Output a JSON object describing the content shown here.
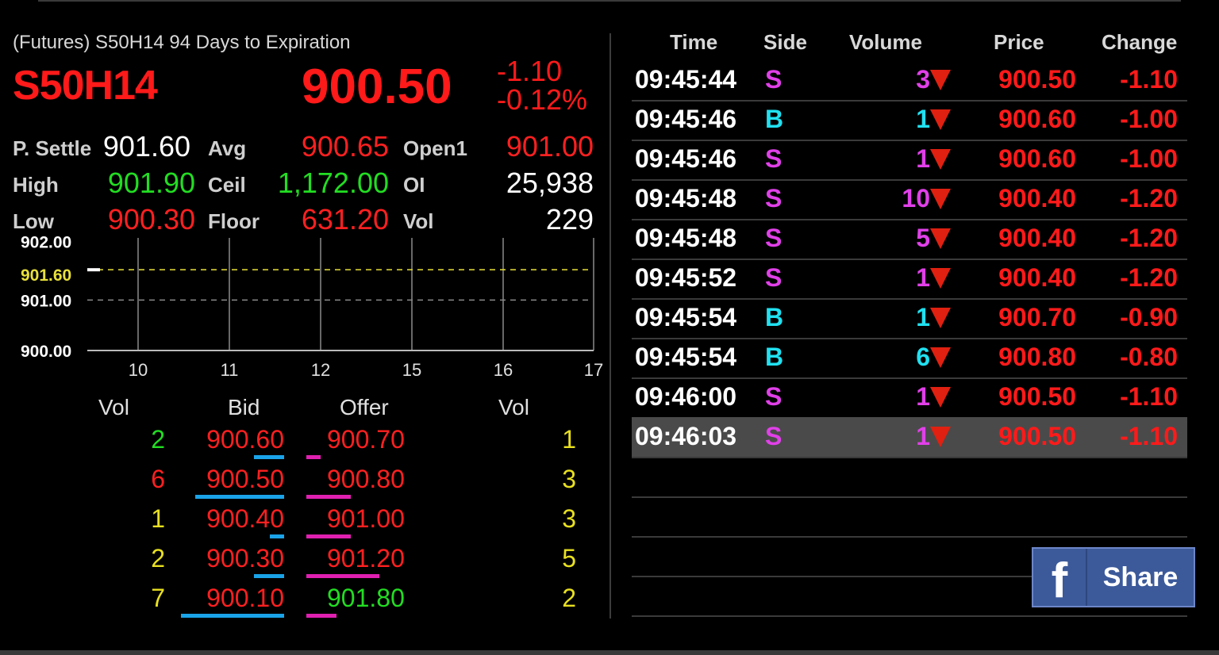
{
  "header": {
    "subtitle": "(Futures) S50H14 94 Days to Expiration",
    "symbol": "S50H14",
    "last": "900.50",
    "change": "-1.10",
    "change_pct": "-0.12%"
  },
  "stats": {
    "p_settle": {
      "label": "P. Settle",
      "value": "901.60",
      "color": "#ffffff"
    },
    "avg": {
      "label": "Avg",
      "value": "900.65",
      "color": "#ff2020"
    },
    "open1": {
      "label": "Open1",
      "value": "901.00",
      "color": "#ff2020"
    },
    "high": {
      "label": "High",
      "value": "901.90",
      "color": "#22dd22"
    },
    "ceil": {
      "label": "Ceil",
      "value": "1,172.00",
      "color": "#22dd22"
    },
    "oi": {
      "label": "OI",
      "value": "25,938",
      "color": "#ffffff"
    },
    "low": {
      "label": "Low",
      "value": "900.30",
      "color": "#ff2020"
    },
    "floor": {
      "label": "Floor",
      "value": "631.20",
      "color": "#ff2020"
    },
    "vol": {
      "label": "Vol",
      "value": "229",
      "color": "#ffffff"
    }
  },
  "chart_data": {
    "type": "line",
    "y_ticks": [
      "902.00",
      "901.60",
      "901.00",
      "900.00"
    ],
    "x_ticks": [
      "10",
      "11",
      "12",
      "15",
      "16",
      "17"
    ],
    "ylim": [
      900.0,
      902.2
    ],
    "reference_lines": [
      {
        "value": 901.6,
        "color": "#e8e03a"
      },
      {
        "value": 901.0,
        "color": "#8a8a8a"
      }
    ],
    "series": [
      {
        "x": [
          9.7
        ],
        "values": [
          901.6
        ],
        "color": "#ffffff"
      }
    ]
  },
  "orderbook": {
    "headers": {
      "bid_vol": "Vol",
      "bid": "Bid",
      "offer": "Offer",
      "ask_vol": "Vol"
    },
    "rows": [
      {
        "bid_vol": "2",
        "bid_vol_color": "#22dd22",
        "bid": "900.60",
        "bid_color": "#ff2020",
        "bid_depth": 0.29,
        "offer": "900.70",
        "offer_color": "#ff2020",
        "ask_depth": 0.14,
        "ask_vol": "1",
        "ask_vol_color": "#e8e020"
      },
      {
        "bid_vol": "6",
        "bid_vol_color": "#ff2020",
        "bid": "900.50",
        "bid_color": "#ff2020",
        "bid_depth": 0.86,
        "offer": "900.80",
        "offer_color": "#ff2020",
        "ask_depth": 0.43,
        "ask_vol": "3",
        "ask_vol_color": "#e8e020"
      },
      {
        "bid_vol": "1",
        "bid_vol_color": "#e8e020",
        "bid": "900.40",
        "bid_color": "#ff2020",
        "bid_depth": 0.14,
        "offer": "901.00",
        "offer_color": "#ff2020",
        "ask_depth": 0.43,
        "ask_vol": "3",
        "ask_vol_color": "#e8e020"
      },
      {
        "bid_vol": "2",
        "bid_vol_color": "#e8e020",
        "bid": "900.30",
        "bid_color": "#ff2020",
        "bid_depth": 0.29,
        "offer": "901.20",
        "offer_color": "#ff2020",
        "ask_depth": 0.71,
        "ask_vol": "5",
        "ask_vol_color": "#e8e020"
      },
      {
        "bid_vol": "7",
        "bid_vol_color": "#e8e020",
        "bid": "900.10",
        "bid_color": "#ff2020",
        "bid_depth": 1.0,
        "offer": "901.80",
        "offer_color": "#22dd22",
        "ask_depth": 0.29,
        "ask_vol": "2",
        "ask_vol_color": "#e8e020"
      }
    ]
  },
  "trades": {
    "headers": {
      "time": "Time",
      "side": "Side",
      "volume": "Volume",
      "price": "Price",
      "change": "Change"
    },
    "side_colors": {
      "S": "#e040e8",
      "B": "#20e0f0"
    },
    "rows": [
      {
        "time": "09:45:44",
        "side": "S",
        "volume": "3",
        "price": "900.50",
        "change": "-1.10"
      },
      {
        "time": "09:45:46",
        "side": "B",
        "volume": "1",
        "price": "900.60",
        "change": "-1.00"
      },
      {
        "time": "09:45:46",
        "side": "S",
        "volume": "1",
        "price": "900.60",
        "change": "-1.00"
      },
      {
        "time": "09:45:48",
        "side": "S",
        "volume": "10",
        "price": "900.40",
        "change": "-1.20"
      },
      {
        "time": "09:45:48",
        "side": "S",
        "volume": "5",
        "price": "900.40",
        "change": "-1.20"
      },
      {
        "time": "09:45:52",
        "side": "S",
        "volume": "1",
        "price": "900.40",
        "change": "-1.20"
      },
      {
        "time": "09:45:54",
        "side": "B",
        "volume": "1",
        "price": "900.70",
        "change": "-0.90"
      },
      {
        "time": "09:45:54",
        "side": "B",
        "volume": "6",
        "price": "900.80",
        "change": "-0.80"
      },
      {
        "time": "09:46:00",
        "side": "S",
        "volume": "1",
        "price": "900.50",
        "change": "-1.10"
      },
      {
        "time": "09:46:03",
        "side": "S",
        "volume": "1",
        "price": "900.50",
        "change": "-1.10",
        "selected": true
      }
    ]
  },
  "share": {
    "icon": "facebook-icon",
    "label": "Share"
  }
}
